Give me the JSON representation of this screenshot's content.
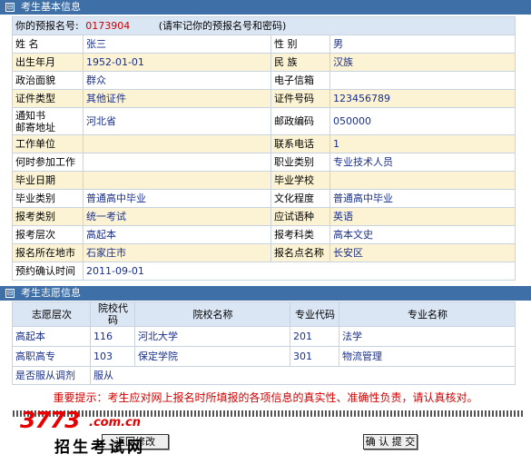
{
  "section1": {
    "toggle": "⊟",
    "title": "考生基本信息"
  },
  "reg": {
    "label": "你的预报名号:",
    "value": "0173904",
    "note": "(请牢记你的预报名号和密码)"
  },
  "rows": [
    {
      "l1": "姓  名",
      "v1": "张三",
      "l2": "性 别",
      "v2": "男"
    },
    {
      "l1": "出生年月",
      "v1": "1952-01-01",
      "l2": "民 族",
      "v2": "汉族"
    },
    {
      "l1": "政治面貌",
      "v1": "群众",
      "l2": "电子信箱",
      "v2": ""
    },
    {
      "l1": "证件类型",
      "v1": "其他证件",
      "l2": "证件号码",
      "v2": "123456789"
    },
    {
      "l1": "通知书\n邮寄地址",
      "v1": "河北省",
      "l2": "邮政编码",
      "v2": "050000"
    },
    {
      "l1": "工作单位",
      "v1": "",
      "l2": "联系电话",
      "v2": "1"
    },
    {
      "l1": "何时参加工作",
      "v1": "",
      "l2": "职业类别",
      "v2": "专业技术人员"
    },
    {
      "l1": "毕业日期",
      "v1": "",
      "l2": "毕业学校",
      "v2": ""
    },
    {
      "l1": "毕业类别",
      "v1": "普通高中毕业",
      "l2": "文化程度",
      "v2": "普通高中毕业"
    },
    {
      "l1": "报考类别",
      "v1": "统一考试",
      "l2": "应试语种",
      "v2": "英语"
    },
    {
      "l1": "报考层次",
      "v1": "高起本",
      "l2": "报考科类",
      "v2": "高本文史"
    },
    {
      "l1": "报名所在地市",
      "v1": "石家庄市",
      "l2": "报名点名称",
      "v2": "长安区"
    }
  ],
  "confirm": {
    "label": "预约确认时间",
    "value": "2011-09-01"
  },
  "section2": {
    "toggle": "⊟",
    "title": "考生志愿信息"
  },
  "vol_headers": [
    "志愿层次",
    "院校代码",
    "院校名称",
    "专业代码",
    "专业名称"
  ],
  "volunteers": [
    {
      "level": "高起本",
      "school_code": "116",
      "school_name": "河北大学",
      "major_code": "201",
      "major_name": "法学"
    },
    {
      "level": "高职高专",
      "school_code": "103",
      "school_name": "保定学院",
      "major_code": "301",
      "major_name": "物流管理"
    }
  ],
  "adjust": {
    "label": "是否服从调剂",
    "value": "服从"
  },
  "notice": "重要提示：考生应对网上报名时所填报的各项信息的真实性、准确性负责，请认真核对。",
  "buttons": {
    "back": "返回修改",
    "confirm": "确 认 提 交"
  },
  "watermark": {
    "main": "3773",
    "domain": ".com.cn",
    "tagline": "招生考试网"
  }
}
